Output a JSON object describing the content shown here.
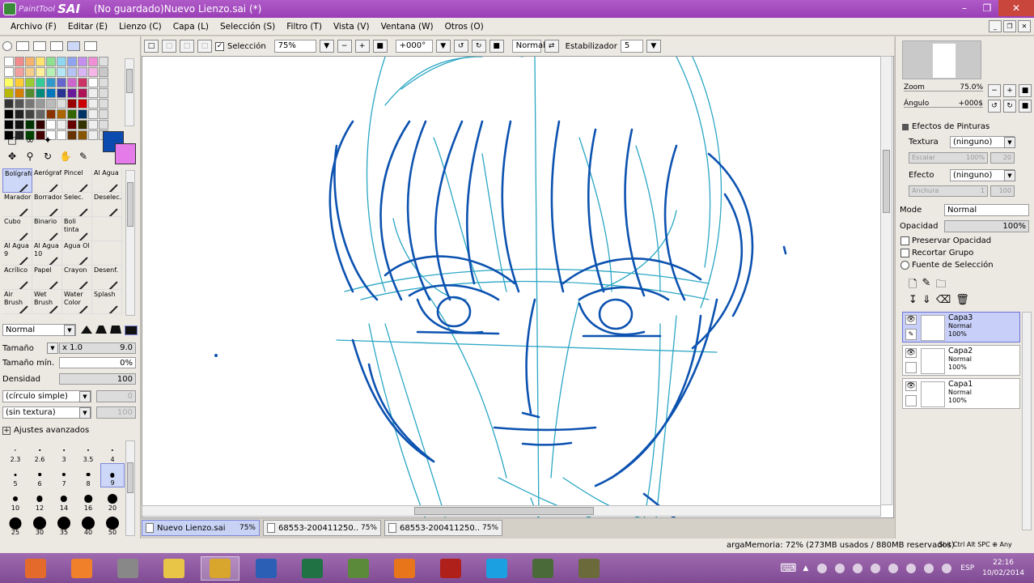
{
  "window": {
    "app_logo_small": "PaintTool",
    "app_logo_big": "SAI",
    "title": "(No guardado)Nuevo Lienzo.sai (*)"
  },
  "menu": [
    "Archivo (F)",
    "Editar (E)",
    "Lienzo (C)",
    "Capa (L)",
    "Selección (S)",
    "Filtro (T)",
    "Vista (V)",
    "Ventana (W)",
    "Otros (O)"
  ],
  "toolbar": {
    "selection_label": "Selección",
    "zoom": "75%",
    "angle": "+000°",
    "mode": "Normal",
    "stabilizer_label": "Estabilizador",
    "stabilizer_value": "5"
  },
  "colors": {
    "primary": "#0b4bb0",
    "secondary": "#e47be8",
    "swatches": [
      "#ffffff",
      "#f28b8b",
      "#f5b36d",
      "#ffe36e",
      "#8fe08f",
      "#8fd6f0",
      "#8fa3f0",
      "#c58ff0",
      "#f08fd5",
      "#e0e0e0",
      "#ffffff",
      "#f5a0a0",
      "#f5cf8a",
      "#fff09a",
      "#b5f0b5",
      "#b5e6f5",
      "#b5c2f5",
      "#d9b5f5",
      "#f5b5e6",
      "#c8c8c8",
      "#ffff66",
      "#ffcc33",
      "#99cc33",
      "#33cc99",
      "#3399cc",
      "#6666cc",
      "#cc66cc",
      "#cc3366",
      "#ffffff",
      "#dddddd",
      "#b8b800",
      "#d48000",
      "#558b2f",
      "#00897b",
      "#0277bd",
      "#283593",
      "#6a1b9a",
      "#ad1457",
      "#eeeeee",
      "#dddddd",
      "#333333",
      "#555555",
      "#777777",
      "#999999",
      "#bbbbbb",
      "#dddddd",
      "#990000",
      "#cc0000",
      "#eeeeee",
      "#dddddd",
      "#000000",
      "#222222",
      "#444444",
      "#666666",
      "#883300",
      "#aa6600",
      "#336600",
      "#003366",
      "#eeeeee",
      "#dddddd",
      "#000000",
      "#111111",
      "#003300",
      "#330000",
      "#ffffff",
      "#eeeeee",
      "#660000",
      "#333300",
      "#eeeeee",
      "#dddddd",
      "#000000",
      "#222222",
      "#004400",
      "#440000",
      "#ffffff",
      "#ffffff",
      "#663300",
      "#885500",
      "#eeeeee",
      "#dddddd"
    ]
  },
  "brushes": [
    {
      "name": "Bolígrafo",
      "selected": true
    },
    {
      "name": "Aerógrafo"
    },
    {
      "name": "Pincel"
    },
    {
      "name": "Al Agua"
    },
    {
      "name": "Marador"
    },
    {
      "name": "Borrador"
    },
    {
      "name": "Selec."
    },
    {
      "name": "Deselec."
    },
    {
      "name": "Cubo"
    },
    {
      "name": "Binario"
    },
    {
      "name": "Boli tinta"
    },
    {
      "name": ""
    },
    {
      "name": "Al Agua 9"
    },
    {
      "name": "Al Agua 10"
    },
    {
      "name": "Agua Ol"
    },
    {
      "name": ""
    },
    {
      "name": "Acrílico"
    },
    {
      "name": "Papel"
    },
    {
      "name": "Crayon"
    },
    {
      "name": "Desenf."
    },
    {
      "name": "Air Brush"
    },
    {
      "name": "Wet Brush"
    },
    {
      "name": "Water Color"
    },
    {
      "name": "Splash"
    }
  ],
  "brush_props": {
    "blend_mode": "Normal",
    "size_label": "Tamaño",
    "size_mult": "x 1.0",
    "size_value": "9.0",
    "min_size_label": "Tamaño mín.",
    "min_size_value": "0%",
    "density_label": "Densidad",
    "density_value": "100",
    "shape": "(círculo simple)",
    "shape_value": "0",
    "texture": "(sin textura)",
    "texture_value": "100",
    "advanced_label": "Ajustes avanzados"
  },
  "brush_sizes": [
    "2.3",
    "2.6",
    "3",
    "3.5",
    "4",
    "5",
    "6",
    "7",
    "8",
    "9",
    "10",
    "12",
    "14",
    "16",
    "20",
    "25",
    "30",
    "35",
    "40",
    "50"
  ],
  "selected_brush_size": "9",
  "tabs": [
    {
      "name": "Nuevo Lienzo.sai",
      "zoom": "75%",
      "active": true
    },
    {
      "name": "68553-200411250...",
      "zoom": "75%",
      "active": false
    },
    {
      "name": "68553-200411250...",
      "zoom": "75%",
      "active": false
    }
  ],
  "navigator": {
    "zoom_label": "Zoom",
    "zoom_value": "75.0%",
    "angle_label": "Ángulo",
    "angle_value": "+000$"
  },
  "effects": {
    "header": "Efectos de Pinturas",
    "texture_label": "Textura",
    "texture_value": "(ninguno)",
    "texture_scale_label": "Escalar",
    "texture_scale_value": "100%",
    "texture_strength_value": "20",
    "effect_label": "Efecto",
    "effect_value": "(ninguno)",
    "effect_width_label": "Anchura",
    "effect_width_value": "1",
    "effect_strength_value": "100"
  },
  "layer_props": {
    "mode_label": "Mode",
    "mode_value": "Normal",
    "opacity_label": "Opacidad",
    "opacity_value": "100%",
    "preserve_opacity": "Preservar Opacidad",
    "clip_group": "Recortar Grupo",
    "selection_source": "Fuente de Selección"
  },
  "layers": [
    {
      "name": "Capa3",
      "mode": "Normal",
      "opacity": "100%",
      "selected": true
    },
    {
      "name": "Capa2",
      "mode": "Normal",
      "opacity": "100%",
      "selected": false
    },
    {
      "name": "Capa1",
      "mode": "Normal",
      "opacity": "100%",
      "selected": false
    }
  ],
  "status": {
    "memory": "argaMemoria: 72% (273MB usados / 880MB reservados)",
    "keys": "Shit Ctrl Alt SPC ⊕ Any"
  },
  "taskbar": {
    "apps": [
      "photo-app",
      "media-app",
      "books-app",
      "file-explorer",
      "paint-tool-sai",
      "word",
      "excel",
      "game-app",
      "firefox",
      "media-player",
      "skype",
      "app-1",
      "app-2"
    ],
    "language": "ESP",
    "time": "22:16",
    "date": "10/02/2014"
  }
}
